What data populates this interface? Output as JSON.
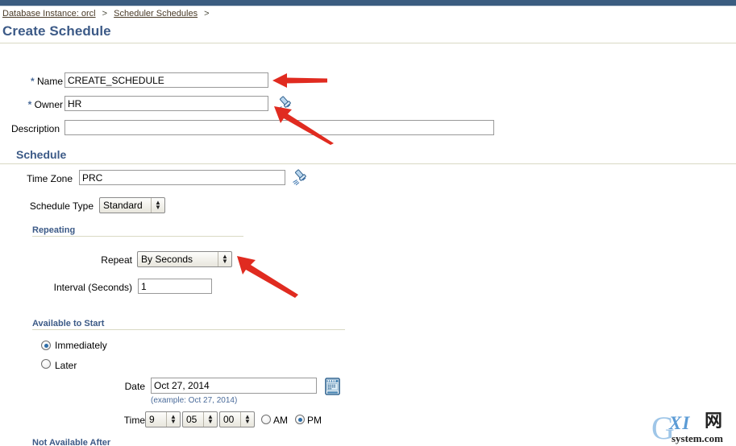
{
  "window": {
    "top_bar_color": "#3b5c80"
  },
  "breadcrumb": {
    "items": [
      {
        "label": "Database Instance: orcl",
        "link": true
      },
      {
        "label": "Scheduler Schedules",
        "link": true
      }
    ],
    "separator": ">"
  },
  "page": {
    "title": "Create Schedule"
  },
  "form": {
    "name": {
      "label": "Name",
      "required_marker": "*",
      "value": "CREATE_SCHEDULE",
      "placeholder": ""
    },
    "owner": {
      "label": "Owner",
      "required_marker": "*",
      "value": "HR",
      "placeholder": "",
      "icon": "flashlight-icon"
    },
    "description": {
      "label": "Description",
      "value": "",
      "placeholder": ""
    }
  },
  "schedule_section": {
    "header": "Schedule",
    "time_zone": {
      "label": "Time Zone",
      "value": "PRC",
      "placeholder": "",
      "icon": "flashlight-icon"
    },
    "schedule_type": {
      "label": "Schedule Type",
      "value": "Standard",
      "options": [
        "Standard"
      ]
    }
  },
  "repeating_section": {
    "header": "Repeating",
    "repeat": {
      "label": "Repeat",
      "value": "By Seconds",
      "options": [
        "By Seconds"
      ]
    },
    "interval": {
      "label": "Interval (Seconds)",
      "value": "1",
      "placeholder": ""
    }
  },
  "available_to_start_section": {
    "header": "Available to Start",
    "immediately": {
      "label": "Immediately",
      "selected": true
    },
    "later": {
      "label": "Later",
      "selected": false
    },
    "date": {
      "label": "Date",
      "value": "Oct 27, 2014",
      "example": "(example: Oct 27, 2014)",
      "icon": "calendar-icon"
    },
    "time": {
      "label": "Time",
      "hour": "9",
      "minute": "05",
      "second": "00",
      "hour_options": [
        "9"
      ],
      "minute_options": [
        "05"
      ],
      "second_options": [
        "00"
      ],
      "am": {
        "label": "AM",
        "selected": false
      },
      "pm": {
        "label": "PM",
        "selected": true
      }
    }
  },
  "not_available_after_section": {
    "header": "Not Available After"
  },
  "watermark": {
    "g": "G",
    "xi": "XI",
    "cn": "网",
    "domain": "system.com"
  }
}
